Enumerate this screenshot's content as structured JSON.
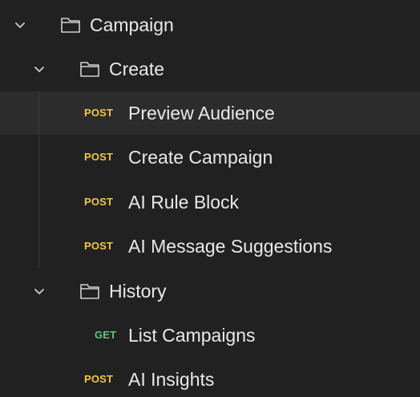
{
  "colors": {
    "background": "#212121",
    "selected_row": "#2c2c2c",
    "post_method": "#f0c64a",
    "get_method": "#64c37b",
    "text": "#e9e9e9"
  },
  "tree": {
    "campaign": {
      "label": "Campaign",
      "icon": "folder-icon",
      "expanded": true
    },
    "create": {
      "label": "Create",
      "icon": "folder-icon",
      "expanded": true
    },
    "requests_create": [
      {
        "method": "POST",
        "label": "Preview Audience",
        "selected": true
      },
      {
        "method": "POST",
        "label": "Create Campaign",
        "selected": false
      },
      {
        "method": "POST",
        "label": "AI Rule Block",
        "selected": false
      },
      {
        "method": "POST",
        "label": "AI Message Suggestions",
        "selected": false
      }
    ],
    "history": {
      "label": "History",
      "icon": "folder-icon",
      "expanded": true
    },
    "requests_history": [
      {
        "method": "GET",
        "label": "List Campaigns",
        "selected": false
      }
    ],
    "requests_campaign": [
      {
        "method": "POST",
        "label": "AI Insights",
        "selected": false
      }
    ]
  }
}
